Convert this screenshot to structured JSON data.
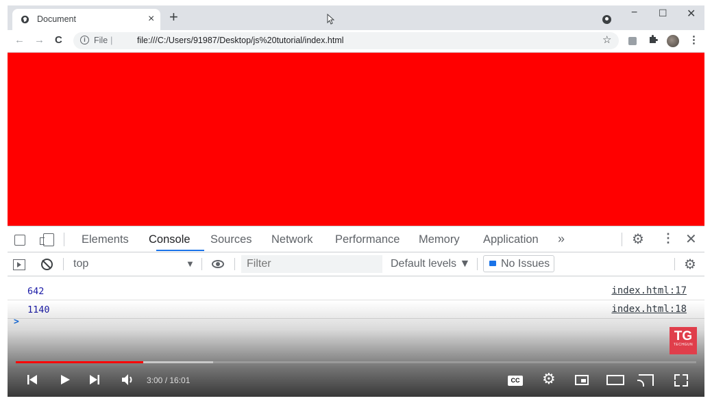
{
  "browser": {
    "tab_title": "Document",
    "tab_close": "×",
    "new_tab": "+",
    "url_prefix": "File",
    "url": "file:///C:/Users/91987/Desktop/js%20tutorial/index.html",
    "window_minimize": "−",
    "window_maximize": "☐",
    "window_close": "✕",
    "back": "←",
    "forward": "→",
    "reload": "C",
    "bookmark_star": "☆",
    "menu": "⋮",
    "extensions_icon": "puzzle-icon"
  },
  "page": {
    "background_color": "#ff0000"
  },
  "devtools": {
    "tabs": [
      "Elements",
      "Console",
      "Sources",
      "Network",
      "Performance",
      "Memory",
      "Application"
    ],
    "active_tab": "Console",
    "more_tabs": "»",
    "close": "✕",
    "kebab": "⋮",
    "context": "top",
    "context_caret": "▼",
    "filter_placeholder": "Filter",
    "levels": "Default levels ▼",
    "issues": "No Issues",
    "logs": [
      {
        "value": "642",
        "source": "index.html:17"
      },
      {
        "value": "1140",
        "source": "index.html:18"
      }
    ],
    "prompt": ">"
  },
  "video": {
    "time": "3:00 / 16:01",
    "progress_played": 0.1875,
    "progress_buffered": 0.29,
    "cc_label": "CC",
    "brand": {
      "main": "TG",
      "sub": "TECHGUN"
    },
    "colors": {
      "played": "#ff0000",
      "brand": "#e03e4b"
    }
  }
}
